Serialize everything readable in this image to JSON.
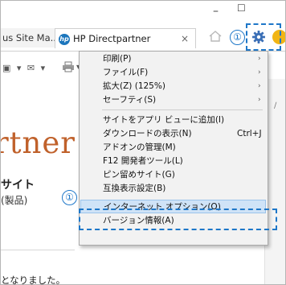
{
  "window": {
    "minimize_glyph": "–",
    "maximize_glyph": "☐"
  },
  "tabs": [
    {
      "label": "us Site Ma..."
    },
    {
      "label": "HP Directpartner",
      "close": "×"
    }
  ],
  "page": {
    "brand_fragment": "rtner",
    "site_heading": "サイト",
    "site_sub": "(製品)",
    "notice": "となりました。"
  },
  "menu": {
    "items": [
      {
        "label": "印刷(P)",
        "submenu": true
      },
      {
        "label": "ファイル(F)",
        "submenu": true
      },
      {
        "label": "拡大(Z) (125%)",
        "submenu": true
      },
      {
        "label": "セーフティ(S)",
        "submenu": true
      },
      {
        "label": "サイトをアプリ ビューに追加(I)"
      },
      {
        "label": "ダウンロードの表示(N)",
        "shortcut": "Ctrl+J"
      },
      {
        "label": "アドオンの管理(M)"
      },
      {
        "label": "F12 開発者ツール(L)"
      },
      {
        "label": "ピン留めサイト(G)"
      },
      {
        "label": "互換表示設定(B)"
      },
      {
        "label": "インターネット オプション(O)",
        "highlighted": true
      },
      {
        "label": "バージョン情報(A)"
      }
    ],
    "arrow_glyph": "›"
  },
  "annotations": {
    "callout_1": "①",
    "callout_2": "①"
  },
  "colors": {
    "accent": "#1e77c8",
    "brand": "#c0612b",
    "highlight": "#cfe3f7"
  }
}
